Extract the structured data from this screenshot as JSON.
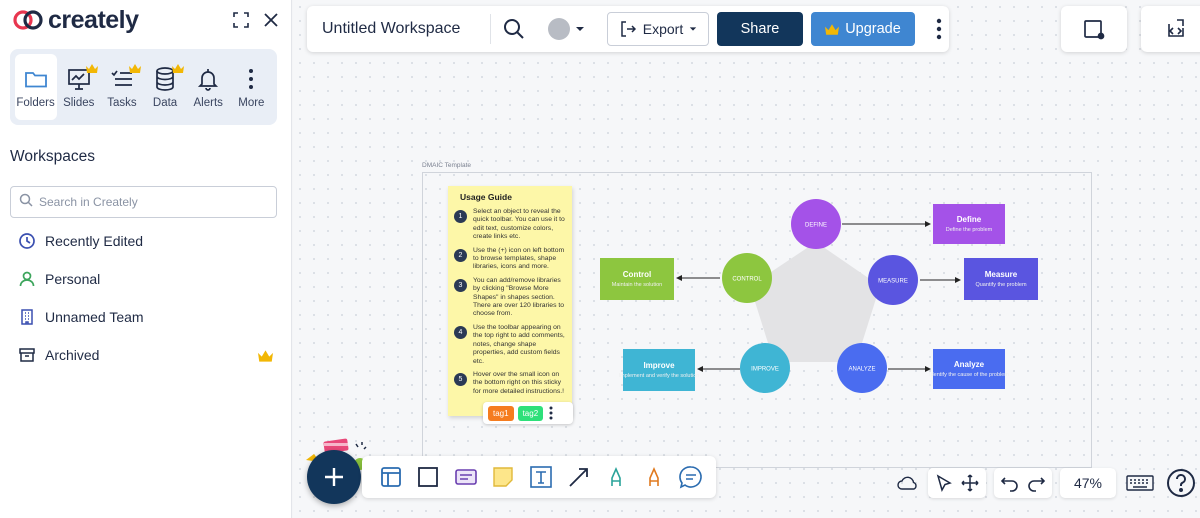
{
  "brand": {
    "name": "creately"
  },
  "apps": [
    {
      "label": "Folders",
      "icon": "folder-icon",
      "active": true,
      "premium": false
    },
    {
      "label": "Slides",
      "icon": "slides-icon",
      "active": false,
      "premium": true
    },
    {
      "label": "Tasks",
      "icon": "tasks-icon",
      "active": false,
      "premium": true
    },
    {
      "label": "Data",
      "icon": "database-icon",
      "active": false,
      "premium": true
    },
    {
      "label": "Alerts",
      "icon": "bell-icon",
      "active": false,
      "premium": false
    },
    {
      "label": "More",
      "icon": "more-vertical-icon",
      "active": false,
      "premium": false
    }
  ],
  "workspaces": {
    "title": "Workspaces",
    "search_placeholder": "Search in Creately",
    "items": [
      {
        "label": "Recently Edited",
        "icon": "clock-icon"
      },
      {
        "label": "Personal",
        "icon": "user-icon"
      },
      {
        "label": "Unnamed Team",
        "icon": "building-icon"
      },
      {
        "label": "Archived",
        "icon": "archive-icon",
        "premium": true
      }
    ]
  },
  "toolbar": {
    "doc_title": "Untitled Workspace",
    "export_label": "Export",
    "share_label": "Share",
    "upgrade_label": "Upgrade"
  },
  "canvas": {
    "frame_label": "DMAIC Template",
    "sticky": {
      "title": "Usage Guide",
      "steps": [
        {
          "num": "1",
          "text": "Select an object to reveal the quick toolbar. You can use it to edit text, customize colors, create links etc."
        },
        {
          "num": "2",
          "text": "Use the (+) icon on left bottom to browse templates, shape libraries, icons and more."
        },
        {
          "num": "3",
          "text": "You can add/remove libraries by clicking \"Browse More Shapes\" in shapes section. There are over 120 libraries to choose from."
        },
        {
          "num": "4",
          "text": "Use the toolbar appearing on the top right to add comments, notes, change shape properties, add custom fields etc."
        },
        {
          "num": "5",
          "text": "Hover over the small icon on the bottom right on this sticky for more detailed instructions.!"
        }
      ],
      "tags": [
        {
          "label": "tag1",
          "color": "#f57c1f"
        },
        {
          "label": "tag2",
          "color": "#2ee07a"
        }
      ]
    },
    "diagram": {
      "circles": [
        {
          "label": "DEFINE",
          "color": "#a452e8"
        },
        {
          "label": "MEASURE",
          "color": "#5a55e0"
        },
        {
          "label": "ANALYZE",
          "color": "#4a6cf0"
        },
        {
          "label": "IMPROVE",
          "color": "#3fb5d4"
        },
        {
          "label": "CONTROL",
          "color": "#8dc63f"
        }
      ],
      "boxes": [
        {
          "title": "Define",
          "subtitle": "Define the problem",
          "color": "#a452e8"
        },
        {
          "title": "Measure",
          "subtitle": "Quantify the problem",
          "color": "#5a55e0"
        },
        {
          "title": "Analyze",
          "subtitle": "Identify the cause of the problem",
          "color": "#4a6cf0"
        },
        {
          "title": "Improve",
          "subtitle": "Implement and verify the solution",
          "color": "#3fb5d4"
        },
        {
          "title": "Control",
          "subtitle": "Maintain the solution",
          "color": "#8dc63f"
        }
      ]
    }
  },
  "zoom": {
    "level": "47%"
  },
  "colors": {
    "navy": "#12365b",
    "blue": "#3f86d1",
    "crown": "#f2b705",
    "logo_red": "#e8364f"
  }
}
